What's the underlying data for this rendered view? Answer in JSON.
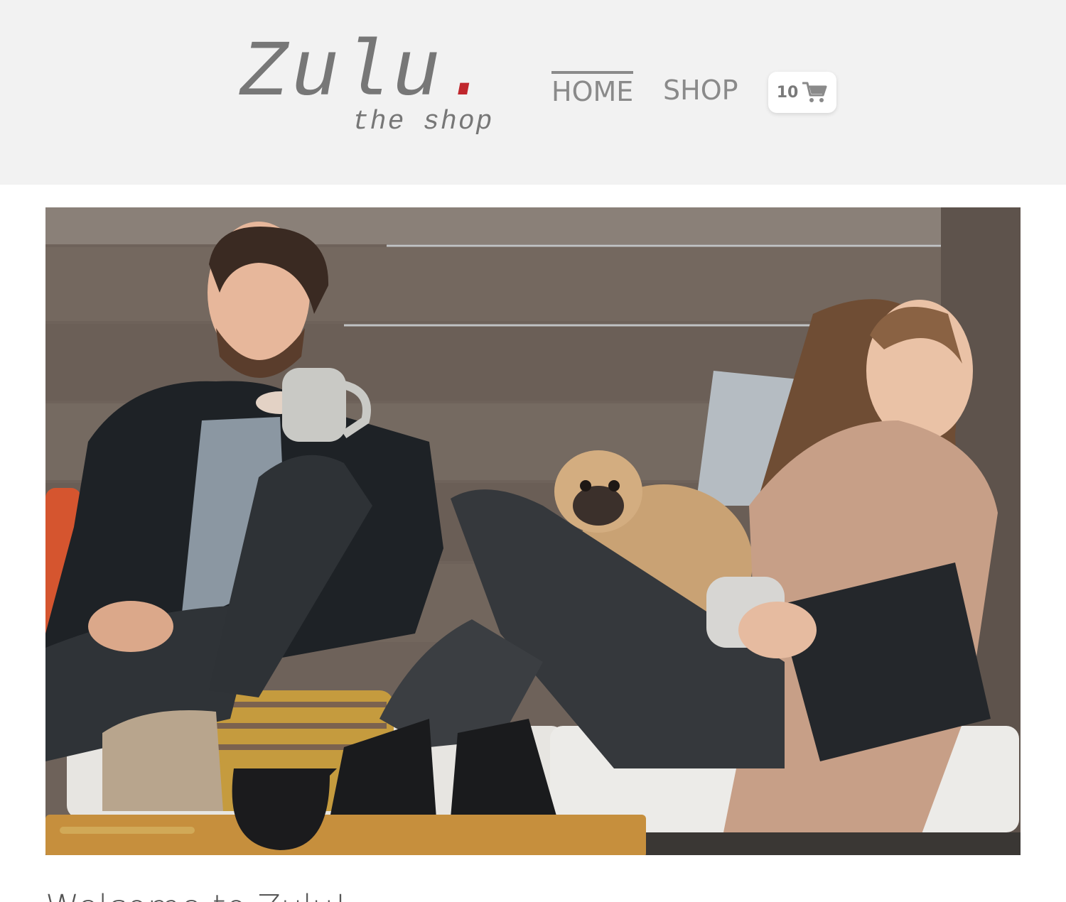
{
  "header": {
    "logo": {
      "word": "Zulu",
      "dot": ".",
      "tagline": "the shop"
    },
    "nav": {
      "home_label": "HOME",
      "shop_label": "SHOP",
      "active": "HOME"
    },
    "cart": {
      "count": "10",
      "icon": "shopping-cart-icon"
    },
    "colors": {
      "background": "#f2f2f2",
      "text": "#777777",
      "accent_dot": "#c0272d"
    }
  },
  "hero": {
    "image": "photo of two people laughing with coffee mugs and a pug on cushions against a wooden fence"
  },
  "main": {
    "welcome_heading": "Welcome to Zulu!"
  }
}
